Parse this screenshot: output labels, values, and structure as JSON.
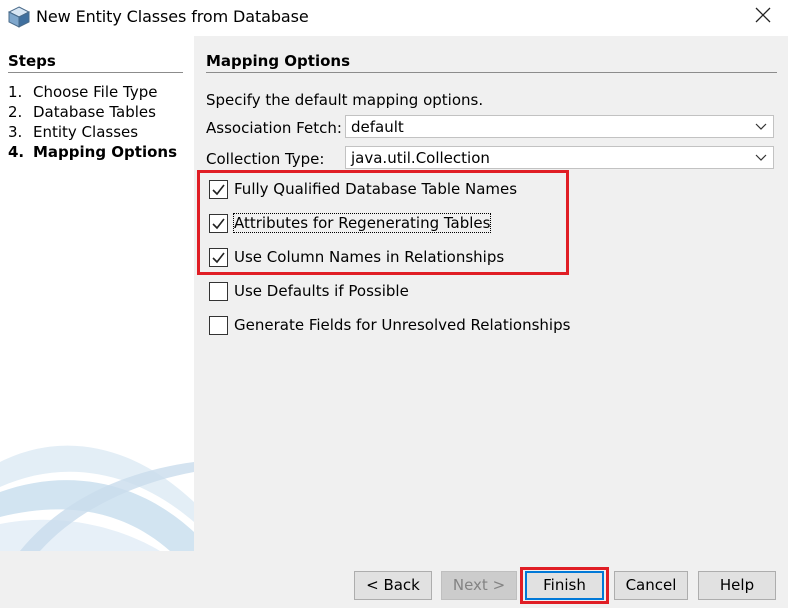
{
  "window": {
    "title": "New Entity Classes from Database",
    "icon": "netbeans-cube-icon",
    "close_icon": "close-icon"
  },
  "steps": {
    "heading": "Steps",
    "items": [
      {
        "num": "1.",
        "label": "Choose File Type",
        "current": false
      },
      {
        "num": "2.",
        "label": "Database Tables",
        "current": false
      },
      {
        "num": "3.",
        "label": "Entity Classes",
        "current": false
      },
      {
        "num": "4.",
        "label": "Mapping Options",
        "current": true
      }
    ]
  },
  "mapping": {
    "heading": "Mapping Options",
    "description": "Specify the default mapping options.",
    "association_fetch": {
      "label": "Association Fetch:",
      "value": "default"
    },
    "collection_type": {
      "label": "Collection Type:",
      "value": "java.util.Collection"
    },
    "checkboxes": [
      {
        "label": "Fully Qualified Database Table Names",
        "checked": true
      },
      {
        "label": "Attributes for Regenerating Tables",
        "checked": true
      },
      {
        "label": "Use Column Names in Relationships",
        "checked": true
      },
      {
        "label": "Use Defaults if Possible",
        "checked": false
      },
      {
        "label": "Generate Fields for Unresolved Relationships",
        "checked": false
      }
    ]
  },
  "buttons": {
    "back": "< Back",
    "next": "Next >",
    "finish": "Finish",
    "cancel": "Cancel",
    "help": "Help"
  },
  "colors": {
    "highlight": "#e01e25",
    "panel_bg": "#f0f0f0",
    "focus_border": "#0078d7"
  }
}
